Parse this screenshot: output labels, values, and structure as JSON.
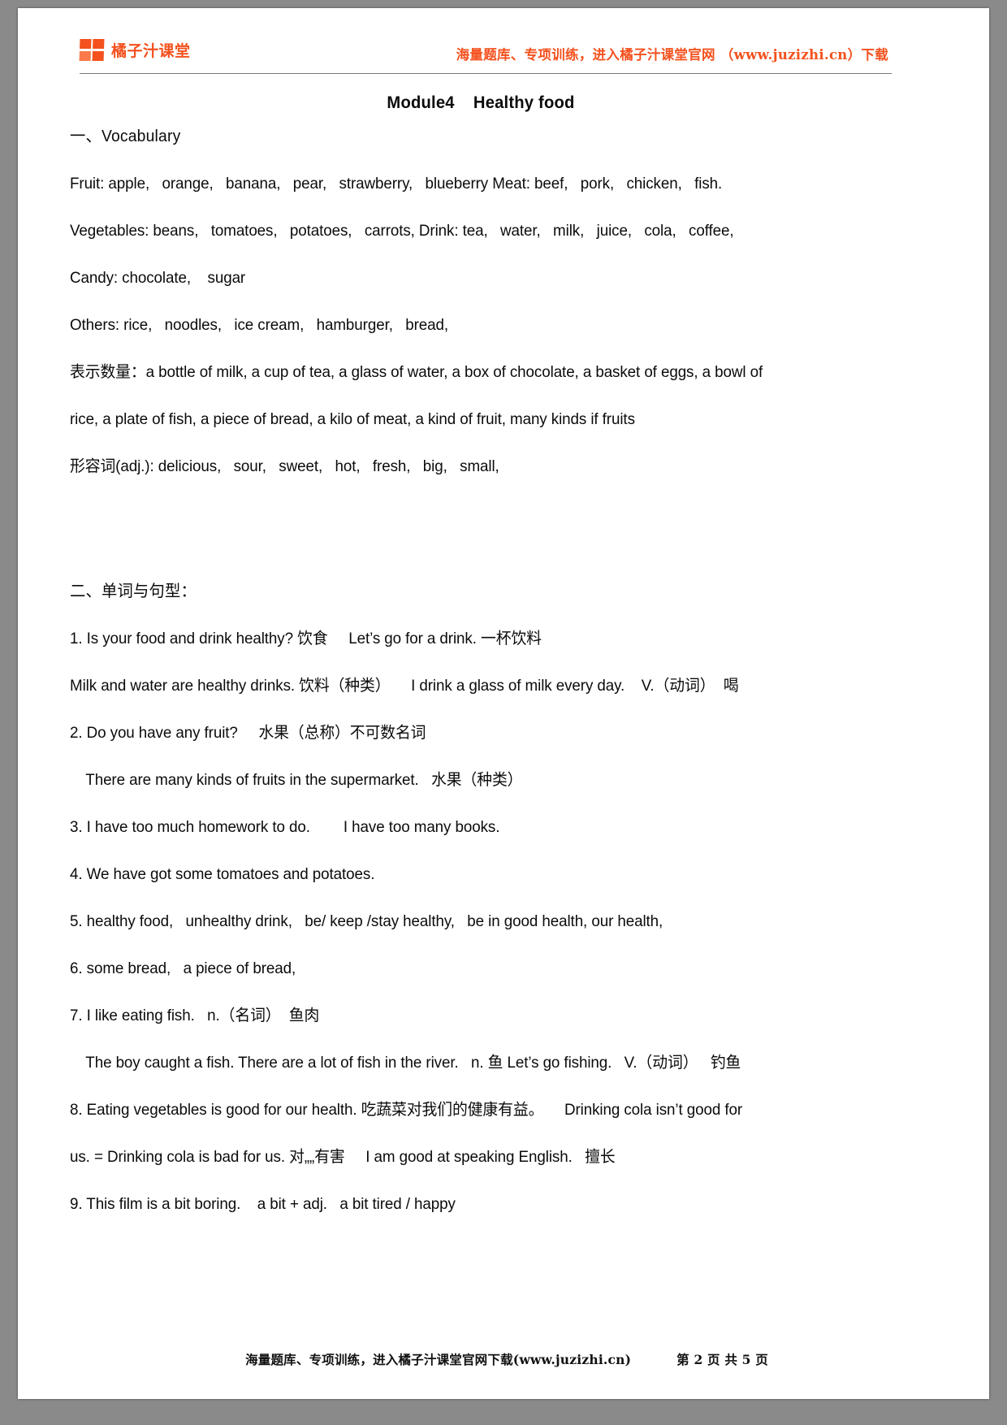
{
  "header": {
    "logo_icon": "four-square-grid-icon",
    "brand_name": "橘子汁课堂",
    "promo_text": "海量题库、专项训练，进入橘子汁课堂官网 （www.juzizhi.cn）下载"
  },
  "document": {
    "title": "Module4    Healthy food",
    "section1": {
      "heading": "一、Vocabulary",
      "lines": [
        "Fruit: apple,   orange,   banana,   pear,   strawberry,   blueberry Meat: beef,   pork,   chicken,   fish.",
        "Vegetables: beans,   tomatoes,   potatoes,   carrots, Drink: tea,   water,   milk,   juice,   cola,   coffee,",
        "Candy: chocolate,    sugar",
        "Others: rice,   noodles,   ice cream,   hamburger,   bread,",
        "表示数量：a bottle of milk, a cup of tea, a glass of water, a box of chocolate, a basket of eggs, a bowl of",
        "rice, a plate of fish, a piece of bread, a kilo of meat, a kind of fruit, many kinds if fruits",
        "形容词(adj.): delicious,   sour,   sweet,   hot,   fresh,   big,   small,"
      ]
    },
    "section2": {
      "heading": "二、单词与句型：",
      "lines": [
        {
          "text": "1. Is your food and drink healthy? 饮食     Let’s go for a drink. 一杯饮料",
          "indent": false
        },
        {
          "text": "Milk and water are healthy drinks. 饮料（种类）     I drink a glass of milk every day.    V.（动词）  喝",
          "indent": false
        },
        {
          "text": "2. Do you have any fruit?     水果（总称）不可数名词",
          "indent": false
        },
        {
          "text": "There are many kinds of fruits in the supermarket.   水果（种类）",
          "indent": true
        },
        {
          "text": "3. I have too much homework to do.        I have too many books.",
          "indent": false
        },
        {
          "text": "4. We have got some tomatoes and potatoes.",
          "indent": false
        },
        {
          "text": "5. healthy food,   unhealthy drink,   be/ keep /stay healthy,   be in good health, our health,",
          "indent": false
        },
        {
          "text": "6. some bread,   a piece of bread,",
          "indent": false
        },
        {
          "text": "7. I like eating fish.   n.（名词）  鱼肉",
          "indent": false
        },
        {
          "text": "The boy caught a fish. There are a lot of fish in the river.   n. 鱼 Let’s go fishing.   V.（动词）   钓鱼",
          "indent": true
        },
        {
          "text": "8. Eating vegetables is good for our health. 吃蔬菜对我们的健康有益。     Drinking cola isn’t good for",
          "indent": false
        },
        {
          "text": "us. = Drinking cola is bad for us. 对„„有害     I am good at speaking English.   擅长",
          "indent": false
        },
        {
          "text": "9. This film is a bit boring.    a bit + adj.   a bit tired / happy",
          "indent": false
        }
      ]
    }
  },
  "footer": {
    "note": "海量题库、专项训练，进入橘子汁课堂官网下载(www.juzizhi.cn)",
    "page_label": "第 2 页 共 5 页"
  }
}
